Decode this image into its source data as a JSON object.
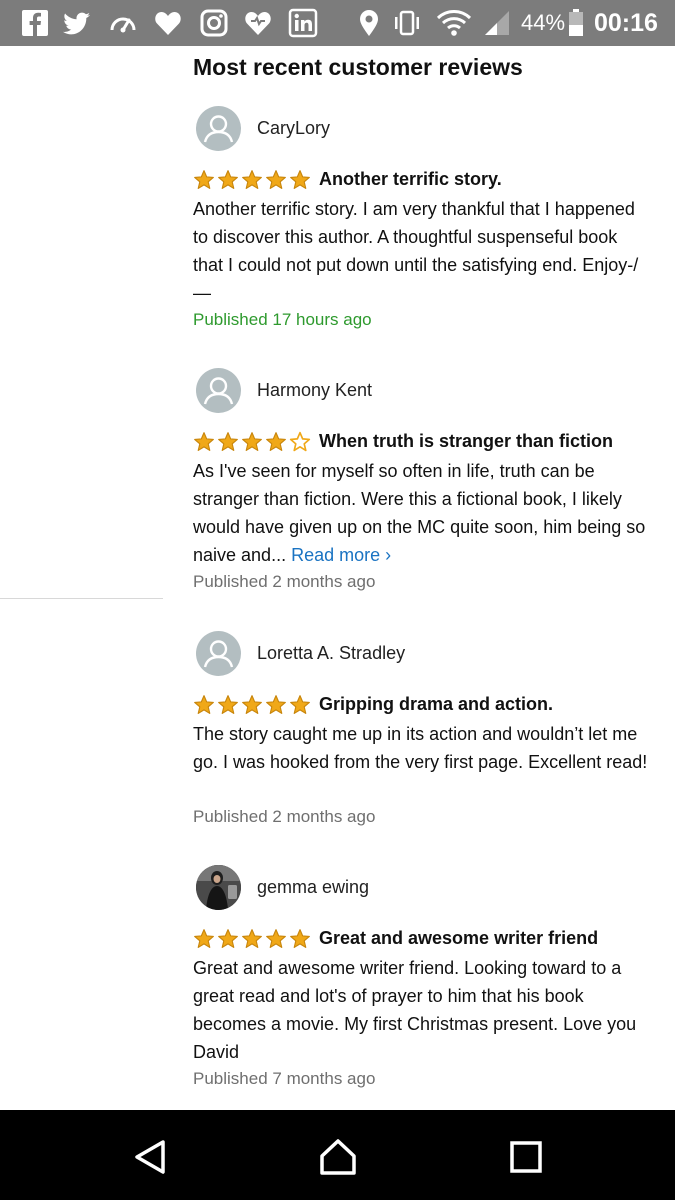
{
  "status_bar": {
    "battery": "44%",
    "time": "00:16",
    "icons": [
      "facebook-icon",
      "twitter-icon",
      "speedometer-icon",
      "heart-icon",
      "instagram-icon",
      "heart-badge-icon",
      "linkedin-icon",
      "location-icon",
      "vibrate-icon",
      "wifi-icon",
      "signal-icon",
      "battery-icon"
    ]
  },
  "page": {
    "title": "Most recent customer reviews"
  },
  "colors": {
    "star": "#f0a818",
    "published_recent": "#2e9a2e",
    "published": "#6f6f6f",
    "link": "#1a73c2",
    "status_bar": "#7c7c7c",
    "nav_bar": "#000000"
  },
  "reviews": [
    {
      "name": "CaryLory",
      "rating": 5,
      "title": "Another terrific story.",
      "body": "Another terrific story. I am very thankful that I happened to discover this author. A thoughtful suspenseful book that I could not put down until the satisfying end. Enjoy-/—",
      "published": "Published 17 hours ago"
    },
    {
      "name": "Harmony Kent",
      "rating": 4,
      "title": "When truth is stranger than fiction",
      "body": "As I've seen for myself so often in life, truth can be stranger than fiction. Were this a fictional book, I likely would have given up on the MC quite soon, him being so naive and...",
      "read_more": "Read more ›",
      "published": "Published 2 months ago"
    },
    {
      "name": "Loretta A. Stradley",
      "rating": 5,
      "title": "Gripping drama and action.",
      "body": "The story caught me up in its action and wouldn’t let me go. I was hooked from the very first page. Excellent read!",
      "published": "Published 2 months ago"
    },
    {
      "name": "gemma ewing",
      "rating": 5,
      "title": "Great and awesome writer friend",
      "body": "Great and awesome writer friend. Looking toward to a great read and lot's of prayer to him that his book becomes a movie. My first Christmas present. Love you David",
      "published": "Published 7 months ago"
    }
  ],
  "nav_bar": {
    "buttons": [
      "back-icon",
      "home-icon",
      "recents-icon"
    ]
  }
}
